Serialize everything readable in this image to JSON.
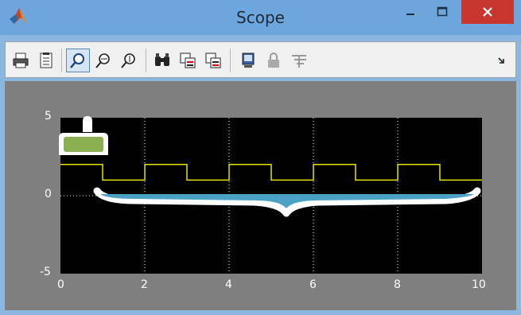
{
  "window": {
    "title": "Scope",
    "titlebar_color": "#6ca6dd",
    "close_color": "#c7372f"
  },
  "toolbar": {
    "buttons": [
      {
        "name": "print-icon",
        "active": false
      },
      {
        "name": "parameters-icon",
        "active": false
      },
      {
        "name": "zoom-icon",
        "active": true
      },
      {
        "name": "zoom-x-icon",
        "active": false
      },
      {
        "name": "zoom-y-icon",
        "active": false
      },
      {
        "name": "autoscale-icon",
        "active": false
      },
      {
        "name": "save-axes-icon",
        "active": false
      },
      {
        "name": "restore-axes-icon",
        "active": false
      },
      {
        "name": "floating-scope-icon",
        "active": false
      },
      {
        "name": "lock-axes-icon",
        "active": false
      },
      {
        "name": "signal-selection-icon",
        "active": false
      }
    ],
    "overflow_icon": "chevron-icon"
  },
  "plot": {
    "background": "#7f7f7f",
    "axes_background": "#000000",
    "trace_color": "#e5e500",
    "brace_color": "#4aa3c7"
  },
  "chart_data": {
    "type": "line",
    "x": [
      0,
      1,
      1,
      2,
      2,
      3,
      3,
      4,
      4,
      5,
      5,
      6,
      6,
      7,
      7,
      8,
      8,
      9,
      9,
      10
    ],
    "series": [
      {
        "values": [
          2,
          2,
          1,
          1,
          2,
          2,
          1,
          1,
          2,
          2,
          1,
          1,
          2,
          2,
          1,
          1,
          2,
          2,
          1,
          1
        ]
      }
    ],
    "xlim": [
      0,
      10
    ],
    "ylim": [
      -5,
      5
    ],
    "x_ticks": [
      "0",
      "2",
      "4",
      "6",
      "8",
      "10"
    ],
    "y_ticks": [
      "5",
      "0",
      "-5"
    ],
    "grid": true,
    "title": "",
    "xlabel": "",
    "ylabel": ""
  }
}
